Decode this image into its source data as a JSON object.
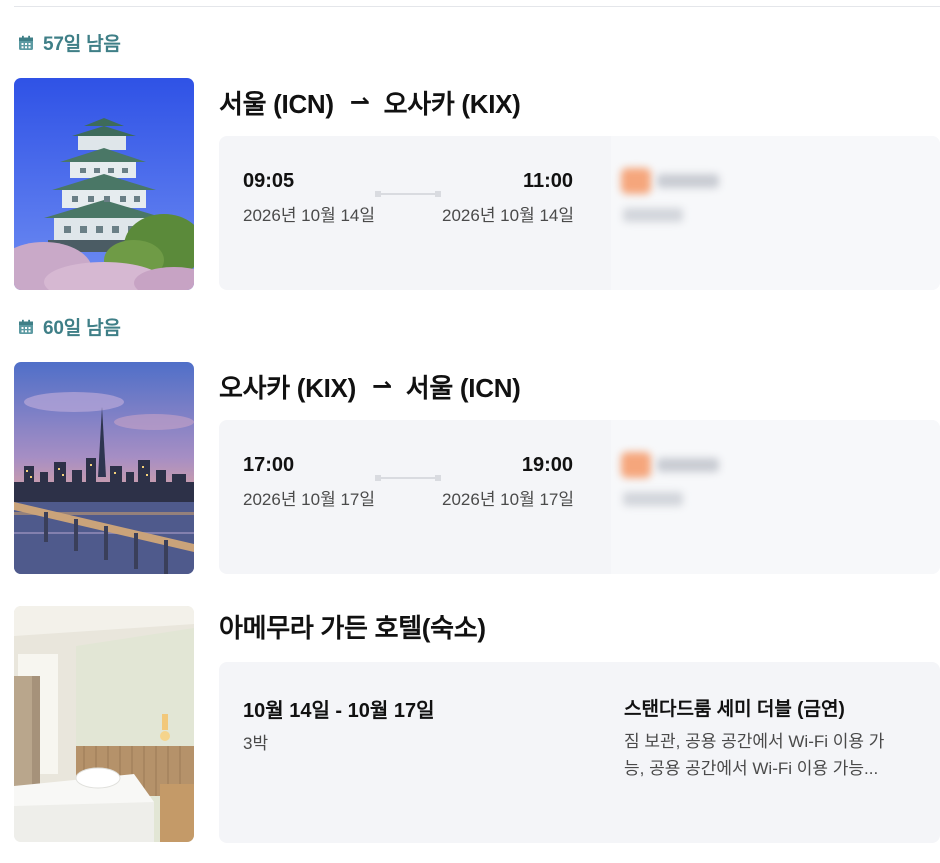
{
  "trips": [
    {
      "countdown": "57일 남음",
      "from": "서울 (ICN)",
      "to": "오사카 (KIX)",
      "arrow": "→",
      "depart_time": "09:05",
      "depart_date": "2026년 10월 14일",
      "arrive_time": "11:00",
      "arrive_date": "2026년 10월 14일",
      "image": "osaka-castle-photo"
    },
    {
      "countdown": "60일 남음",
      "from": "오사카 (KIX)",
      "to": "서울 (ICN)",
      "arrow": "→",
      "depart_time": "17:00",
      "depart_date": "2026년 10월 17일",
      "arrive_time": "19:00",
      "arrive_date": "2026년 10월 17일",
      "image": "seoul-skyline-photo"
    }
  ],
  "hotel": {
    "title": "아메무라 가든 호텔(숙소)",
    "dates": "10월 14일 - 10월 17일",
    "nights": "3박",
    "room_name": "스탠다드룸 세미 더블 (금연)",
    "room_desc": "짐 보관, 공용 공간에서 Wi-Fi 이용 가능, 공용 공간에서 Wi-Fi 이용 가능...",
    "image": "hotel-room-photo"
  },
  "colors": {
    "countdown": "#3f7f87",
    "card_bg": "#f4f5f8",
    "text": "#111111",
    "muted": "#4a4a4a"
  },
  "icons": {
    "countdown": "calendar-icon",
    "route": "arrow-right-icon"
  }
}
